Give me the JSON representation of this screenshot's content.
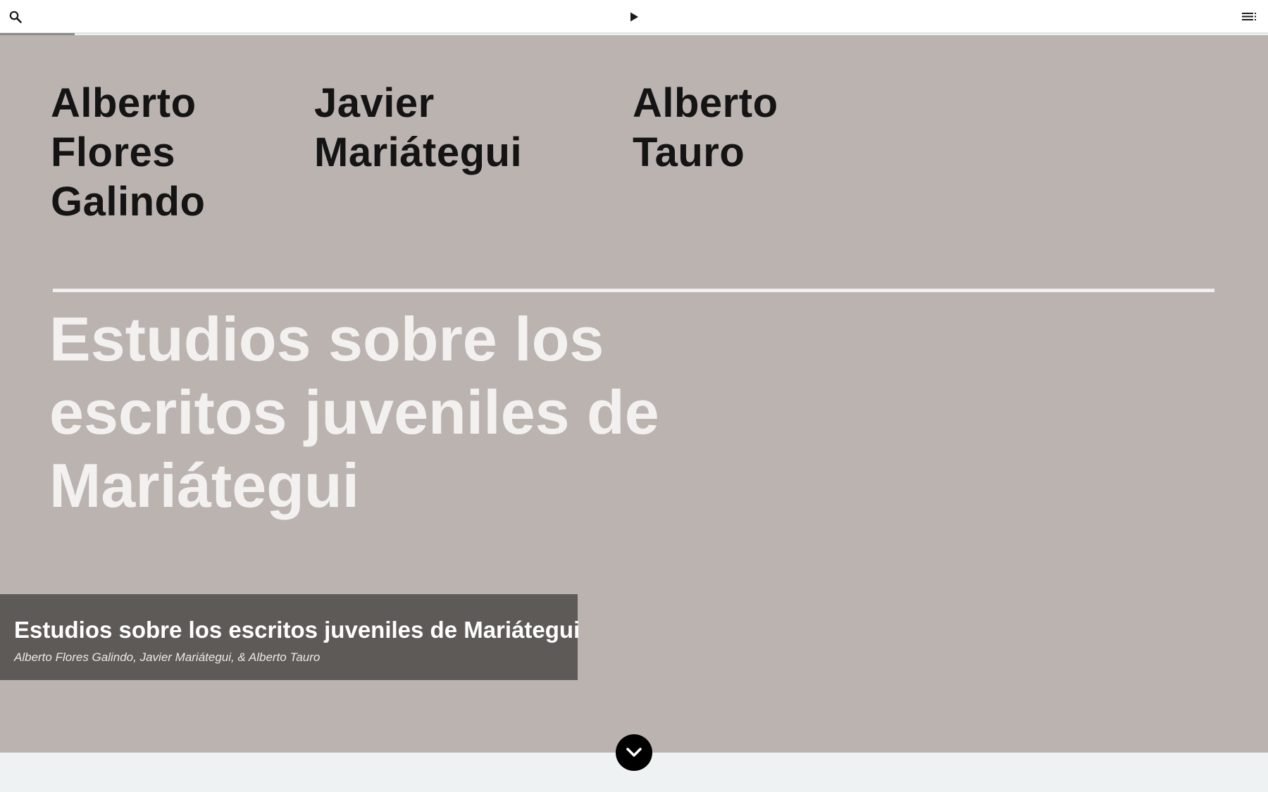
{
  "toolbar": {
    "search_icon": "search-icon",
    "play_icon": "play-icon",
    "toc_icon": "table-of-contents-icon"
  },
  "cover": {
    "authors": [
      {
        "lines": [
          "Alberto",
          "Flores",
          "Galindo"
        ]
      },
      {
        "lines": [
          "Javier",
          "Mariátegui"
        ]
      },
      {
        "lines": [
          "Alberto",
          "Tauro"
        ]
      }
    ],
    "title_lines": [
      "Estudios sobre los",
      "escritos juveniles de",
      "Mariátegui"
    ],
    "background_color": "#bbb3af"
  },
  "caption": {
    "title": "Estudios sobre los escritos juveniles de Mariátegui",
    "authors": "Alberto Flores Galindo, Javier Mariátegui, & Alberto Tauro"
  },
  "scroll": {
    "icon": "chevron-down-icon"
  }
}
